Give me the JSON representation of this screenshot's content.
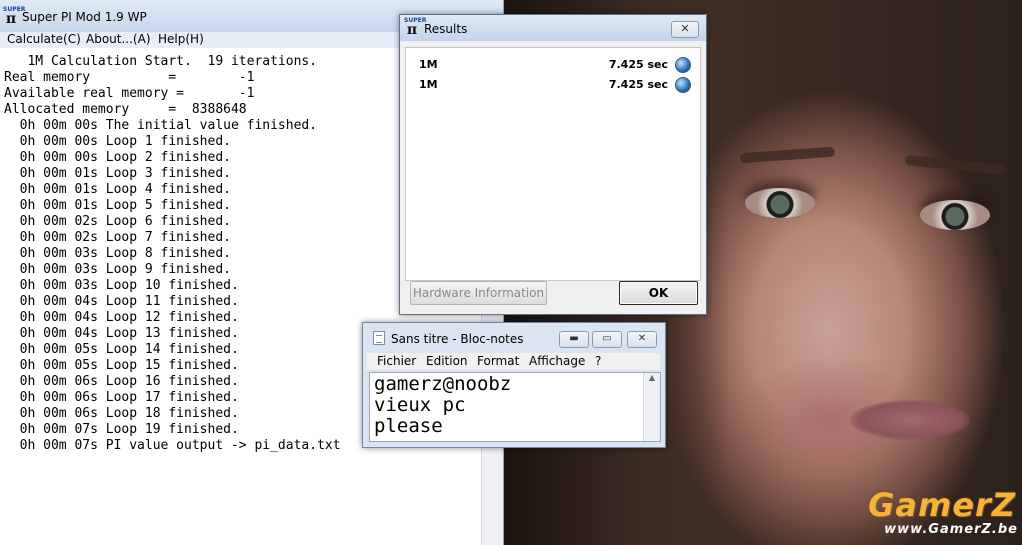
{
  "superpi": {
    "title": "Super PI Mod 1.9 WP",
    "icon_text": "SUPER",
    "icon_glyph": "π",
    "menu": [
      "Calculate(C)",
      "About...(A)",
      "Help(H)"
    ],
    "console_lines": [
      "   1M Calculation Start.  19 iterations.",
      "Real memory          =        -1",
      "Available real memory =       -1",
      "Allocated memory     =  8388648",
      "  0h 00m 00s The initial value finished.",
      "  0h 00m 00s Loop 1 finished.",
      "  0h 00m 00s Loop 2 finished.",
      "  0h 00m 01s Loop 3 finished.",
      "  0h 00m 01s Loop 4 finished.",
      "  0h 00m 01s Loop 5 finished.",
      "  0h 00m 02s Loop 6 finished.",
      "  0h 00m 02s Loop 7 finished.",
      "  0h 00m 03s Loop 8 finished.",
      "  0h 00m 03s Loop 9 finished.",
      "  0h 00m 03s Loop 10 finished.",
      "  0h 00m 04s Loop 11 finished.",
      "  0h 00m 04s Loop 12 finished.",
      "  0h 00m 04s Loop 13 finished.",
      "  0h 00m 05s Loop 14 finished.",
      "  0h 00m 05s Loop 15 finished.",
      "  0h 00m 06s Loop 16 finished.",
      "  0h 00m 06s Loop 17 finished.",
      "  0h 00m 06s Loop 18 finished.",
      "  0h 00m 07s Loop 19 finished.",
      "  0h 00m 07s PI value output -> pi_data.txt"
    ]
  },
  "results": {
    "title": "Results",
    "close_glyph": "✕",
    "rows": [
      {
        "label": "1M",
        "value": "7.425 sec"
      },
      {
        "label": "1M",
        "value": "7.425 sec"
      }
    ],
    "hardware_button": "Hardware Information",
    "ok_button": "OK"
  },
  "notepad": {
    "title": "Sans titre - Bloc-notes",
    "minimize_glyph": "▬",
    "maximize_glyph": "▭",
    "close_glyph": "✕",
    "menu": [
      "Fichier",
      "Edition",
      "Format",
      "Affichage",
      "?"
    ],
    "text_lines": [
      "gamerz@noobz",
      "vieux pc",
      "please"
    ]
  },
  "watermark": {
    "brand": "GamerZ",
    "url": "www.GamerZ.be"
  }
}
